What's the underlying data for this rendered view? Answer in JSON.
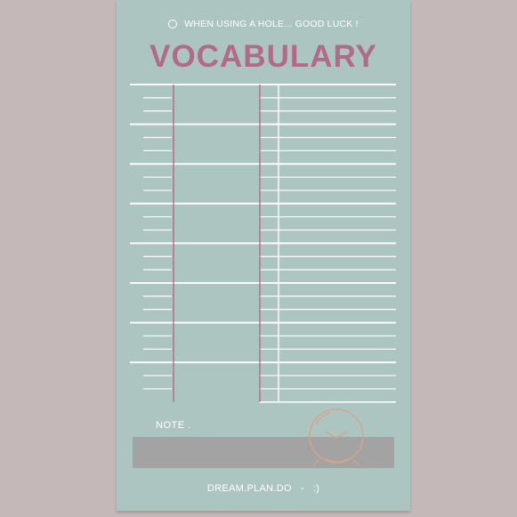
{
  "header": {
    "hole_text": "WHEN USING A HOLE... GOOD LUCK !",
    "title": "VOCABULARY"
  },
  "note": {
    "label": "NOTE ."
  },
  "footer": {
    "brand": "DREAM.PLAN.DO",
    "dash": "-",
    "smiley": ":)"
  },
  "icons": [
    "hole-icon",
    "clock-icon"
  ],
  "colors": {
    "background": "#c4b8b8",
    "card": "#adc5c1",
    "title": "#b06a8a",
    "divider": "#b06a8a",
    "note_box": "#a3a3a3",
    "clock": "#d4a58a"
  },
  "table": {
    "entries": 8,
    "sub_lines_per_entry": 2
  }
}
